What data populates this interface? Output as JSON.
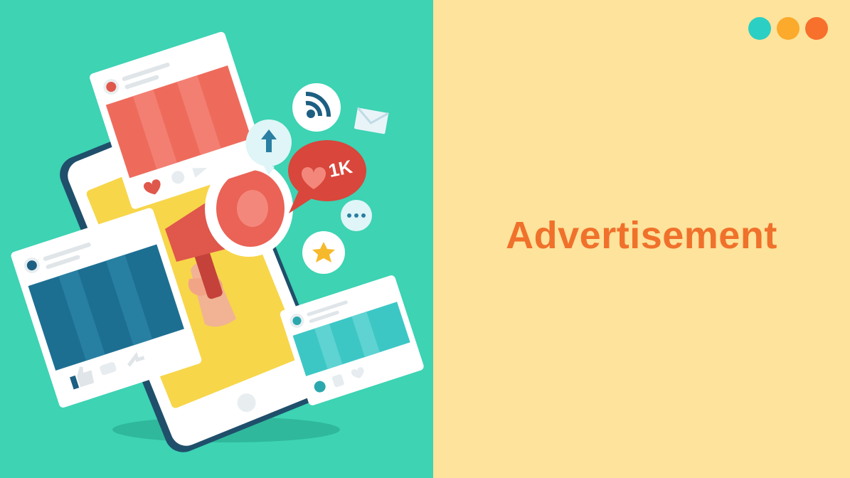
{
  "slide": {
    "title": "Advertisement",
    "colors": {
      "left_background": "#3dd3b3",
      "right_background": "#fde39b",
      "title_color": "#f0712b",
      "dot_colors": [
        "#2ccfc3",
        "#fbaa2c",
        "#f7702c"
      ]
    }
  },
  "illustration": {
    "badge_label": "1K",
    "icons": [
      "wifi-icon",
      "envelope-icon",
      "arrow-up-icon",
      "heart-icon",
      "ellipsis-icon",
      "star-icon",
      "megaphone-icon",
      "like-icon"
    ]
  }
}
